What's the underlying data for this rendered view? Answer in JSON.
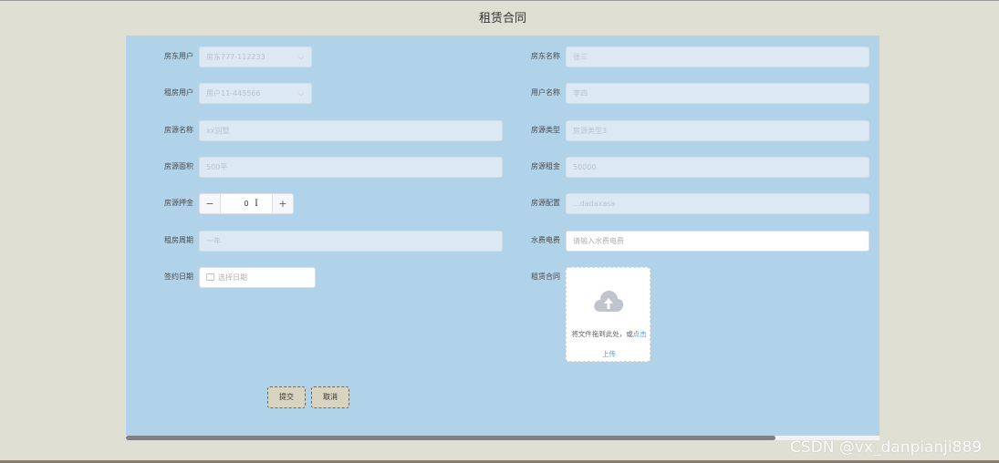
{
  "page": {
    "title": "租赁合同"
  },
  "form": {
    "landlord_user": {
      "label": "房东用户",
      "value": "房东777-112233"
    },
    "landlord_name": {
      "label": "房东名称",
      "value": "张三"
    },
    "tenant_user": {
      "label": "租房用户",
      "value": "用户11-445566"
    },
    "user_name": {
      "label": "用户名称",
      "value": "李四"
    },
    "house_name": {
      "label": "房源名称",
      "value": "xx别墅"
    },
    "house_type": {
      "label": "房源类型",
      "value": "房源类型3"
    },
    "house_area": {
      "label": "房源面积",
      "value": "500平"
    },
    "house_rent": {
      "label": "房源租金",
      "value": "50000"
    },
    "deposit": {
      "label": "房源押金",
      "value": "0",
      "minus": "−",
      "plus": "+"
    },
    "config": {
      "label": "房源配置",
      "value": "...dadaxasa"
    },
    "rent_period": {
      "label": "租房周期",
      "value": "一年"
    },
    "utilities": {
      "label": "水费电费",
      "placeholder": "请输入水费电费"
    },
    "sign_date": {
      "label": "签约日期",
      "placeholder": "选择日期"
    },
    "contract": {
      "label": "租赁合同",
      "drag_text": "将文件拖到此处，或",
      "click_text": "点击",
      "upload_text": "上传"
    }
  },
  "buttons": {
    "submit": "提交",
    "cancel": "取消"
  },
  "watermark": "CSDN @vx_danpianji889",
  "colors": {
    "panel": "#b0d3ea",
    "background": "#e0dfd4",
    "link": "#409eff"
  }
}
